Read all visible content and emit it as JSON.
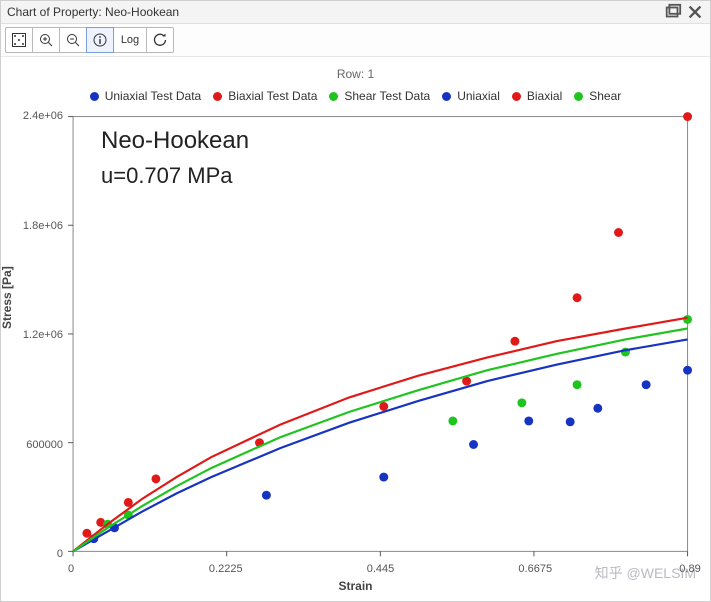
{
  "window": {
    "title": "Chart of Property: Neo-Hookean"
  },
  "toolbar": {
    "items": [
      {
        "name": "fit-extents",
        "hint": "fit"
      },
      {
        "name": "zoom-in",
        "hint": "+"
      },
      {
        "name": "zoom-out",
        "hint": "-"
      },
      {
        "name": "info",
        "hint": "i",
        "selected": true
      },
      {
        "name": "log-scale",
        "label": "Log"
      },
      {
        "name": "refresh",
        "hint": "↻"
      }
    ]
  },
  "chart_data": {
    "type": "scatter+line",
    "title": "Row: 1",
    "xlabel": "Strain",
    "ylabel": "Stress [Pa]",
    "xlim": [
      0,
      0.89
    ],
    "ylim": [
      0,
      2400000
    ],
    "xticks": [
      0,
      0.2225,
      0.445,
      0.6675,
      0.89
    ],
    "yticks": [
      0,
      600000,
      1200000,
      1800000,
      2400000
    ],
    "ytick_labels": [
      "0",
      "600000",
      "1.2e+06",
      "1.8e+06",
      "2.4e+06"
    ],
    "legend": [
      "Uniaxial Test Data",
      "Biaxial Test Data",
      "Shear Test Data",
      "Uniaxial",
      "Biaxial",
      "Shear"
    ],
    "annotation": {
      "line1": "Neo-Hookean",
      "line2": "u=0.707 MPa"
    },
    "colors": {
      "uniaxial": "#1733c2",
      "biaxial": "#e01919",
      "shear": "#1fc41f"
    },
    "series": [
      {
        "name": "Uniaxial Test Data",
        "kind": "scatter",
        "color": "#1733c2",
        "x": [
          0.03,
          0.06,
          0.28,
          0.45,
          0.58,
          0.66,
          0.72,
          0.76,
          0.83,
          0.89
        ],
        "y": [
          70000,
          130000,
          310000,
          410000,
          590000,
          720000,
          715000,
          790000,
          920000,
          1000000
        ]
      },
      {
        "name": "Biaxial Test Data",
        "kind": "scatter",
        "color": "#e01919",
        "x": [
          0.02,
          0.04,
          0.08,
          0.12,
          0.27,
          0.45,
          0.57,
          0.64,
          0.73,
          0.79,
          0.89
        ],
        "y": [
          100000,
          160000,
          270000,
          400000,
          600000,
          800000,
          940000,
          1160000,
          1400000,
          1760000,
          2400000
        ]
      },
      {
        "name": "Shear Test Data",
        "kind": "scatter",
        "color": "#1fc41f",
        "x": [
          0.05,
          0.08,
          0.55,
          0.65,
          0.73,
          0.8,
          0.89
        ],
        "y": [
          150000,
          200000,
          720000,
          820000,
          920000,
          1100000,
          1280000
        ]
      },
      {
        "name": "Uniaxial",
        "kind": "line",
        "color": "#1733c2",
        "x": [
          0,
          0.05,
          0.1,
          0.15,
          0.2,
          0.3,
          0.4,
          0.5,
          0.6,
          0.7,
          0.8,
          0.89
        ],
        "y": [
          0,
          110000,
          220000,
          320000,
          410000,
          570000,
          710000,
          830000,
          940000,
          1030000,
          1110000,
          1170000
        ]
      },
      {
        "name": "Biaxial",
        "kind": "line",
        "color": "#e01919",
        "x": [
          0,
          0.05,
          0.1,
          0.15,
          0.2,
          0.3,
          0.4,
          0.5,
          0.6,
          0.7,
          0.8,
          0.89
        ],
        "y": [
          0,
          150000,
          290000,
          410000,
          520000,
          700000,
          850000,
          970000,
          1070000,
          1160000,
          1230000,
          1290000
        ]
      },
      {
        "name": "Shear",
        "kind": "line",
        "color": "#1fc41f",
        "x": [
          0,
          0.05,
          0.1,
          0.15,
          0.2,
          0.3,
          0.4,
          0.5,
          0.6,
          0.7,
          0.8,
          0.89
        ],
        "y": [
          0,
          130000,
          250000,
          360000,
          460000,
          630000,
          770000,
          890000,
          1000000,
          1090000,
          1170000,
          1230000
        ]
      }
    ]
  },
  "watermark": "知乎 @WELSIM"
}
